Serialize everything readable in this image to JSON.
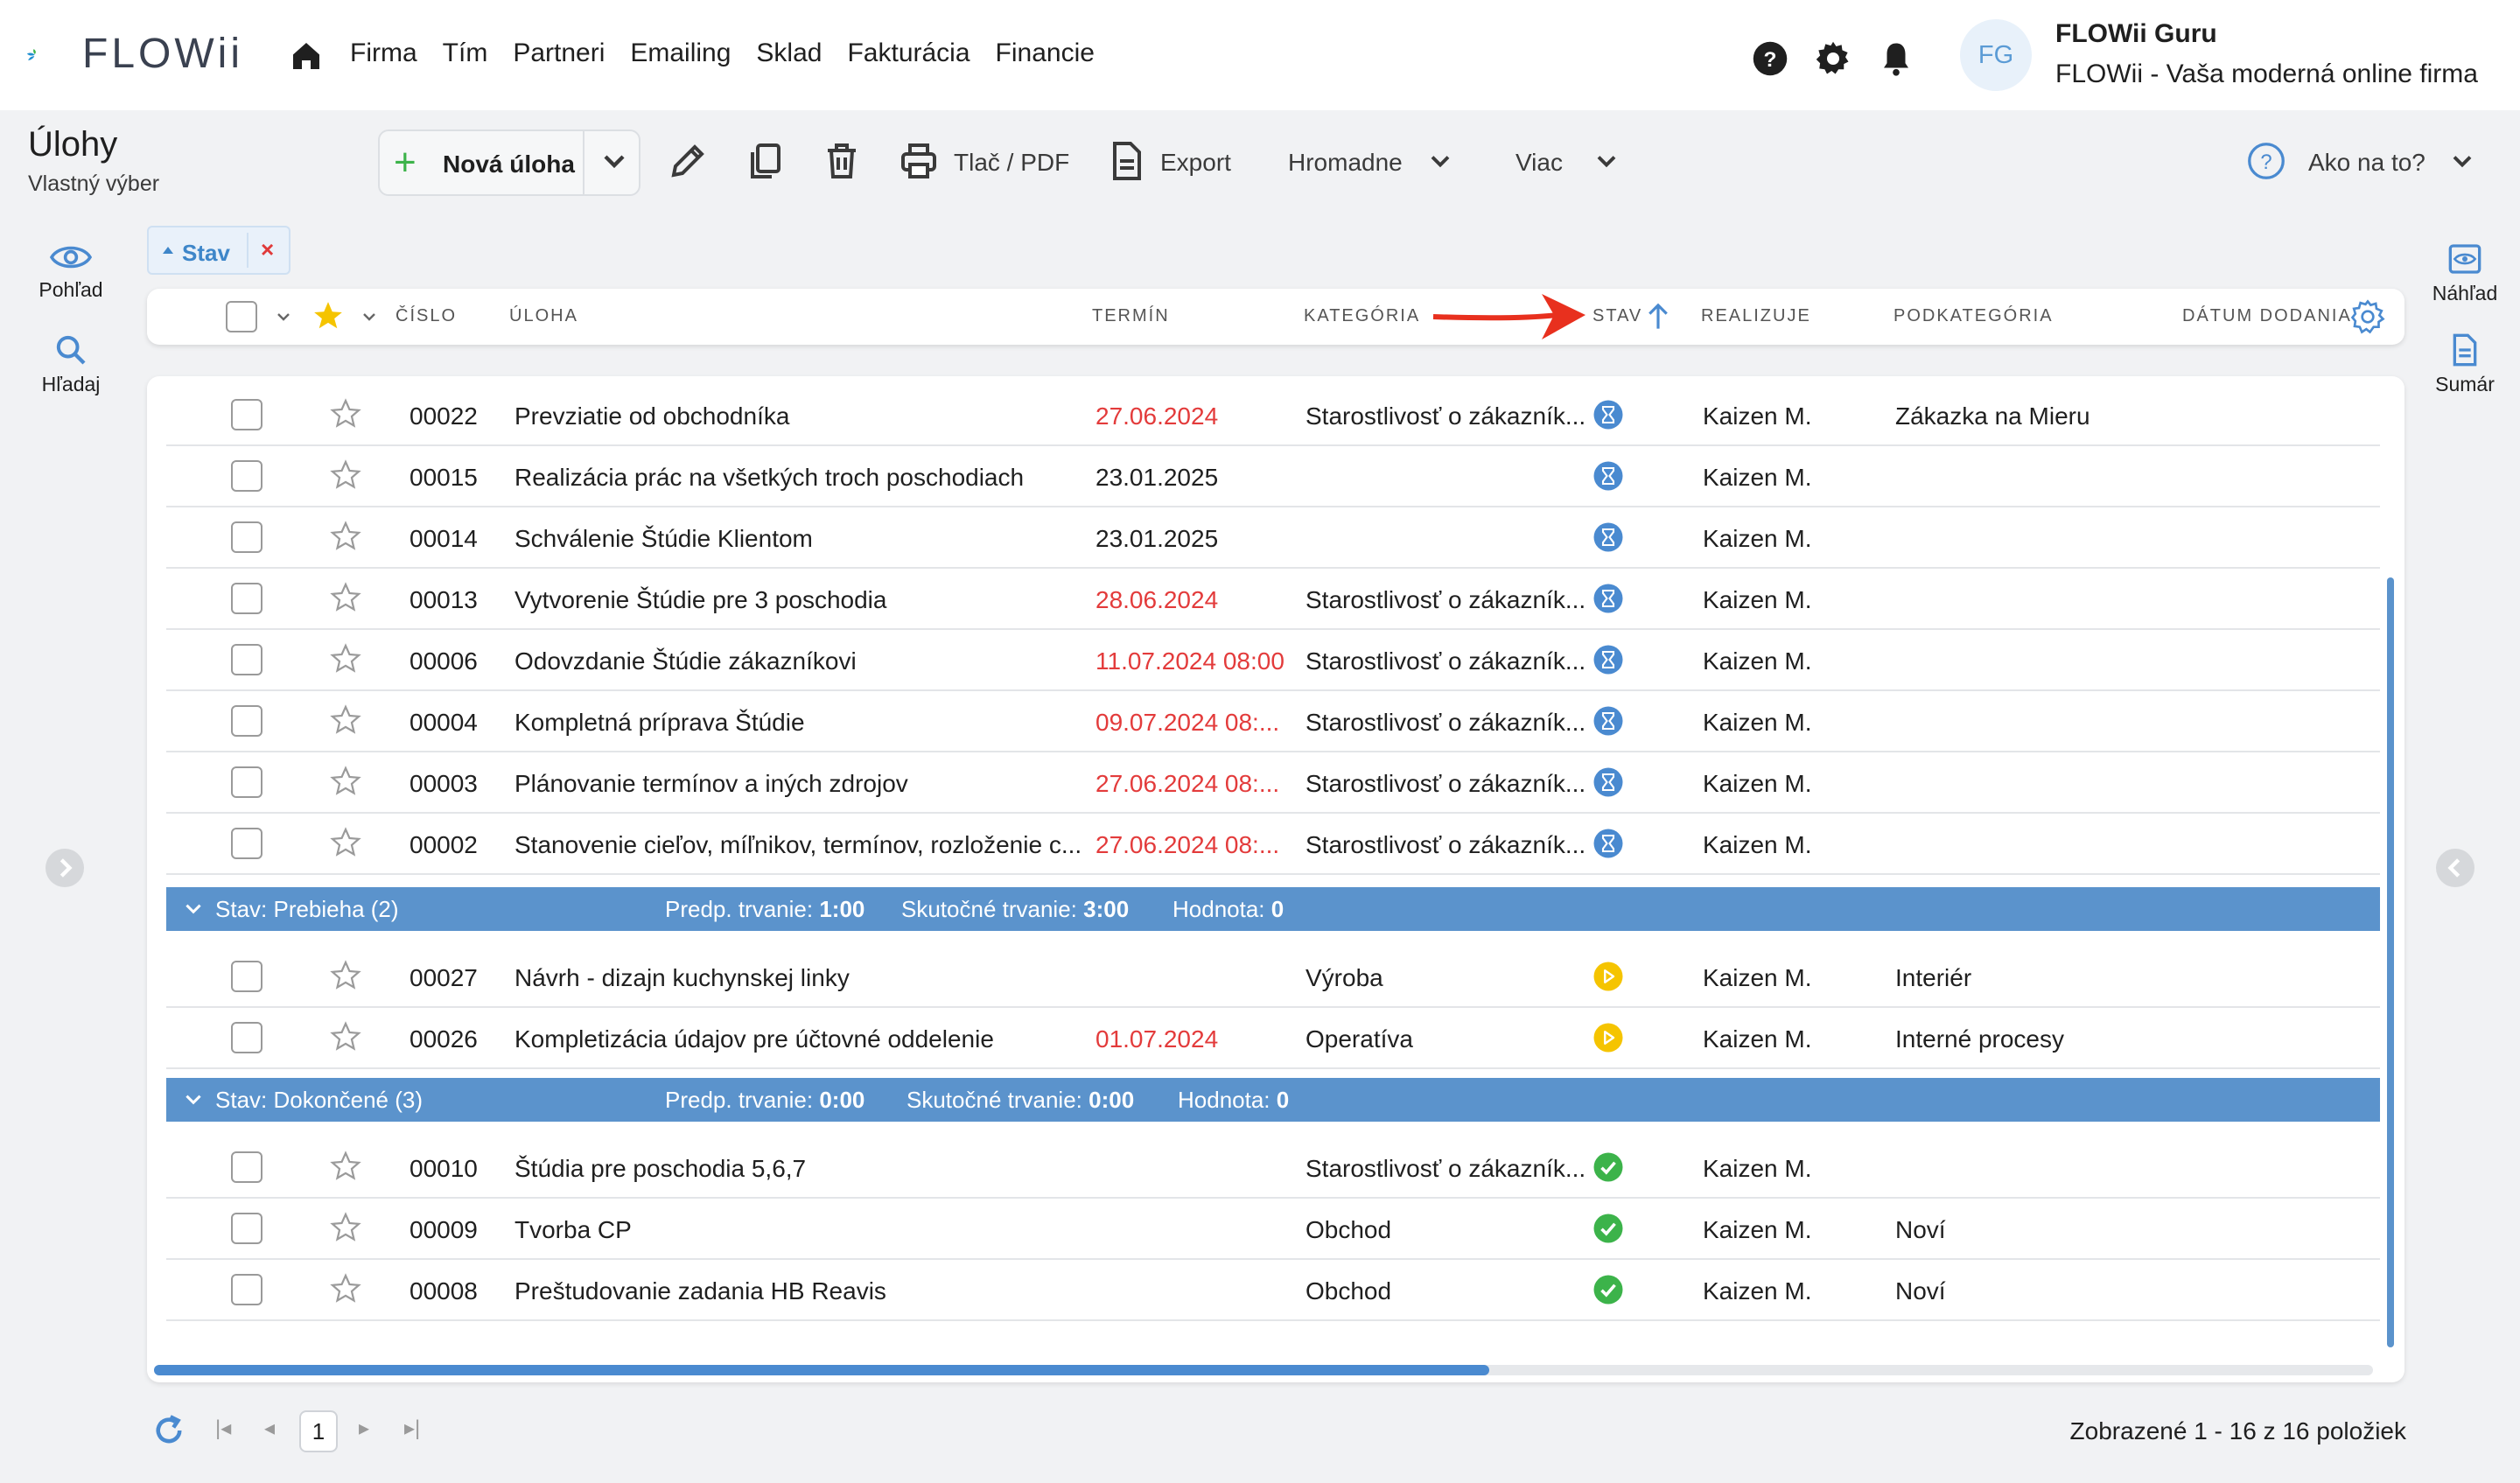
{
  "brand": {
    "name": "FLOWii"
  },
  "nav": [
    "Firma",
    "Tím",
    "Partneri",
    "Emailing",
    "Sklad",
    "Fakturácia",
    "Financie"
  ],
  "user": {
    "initials": "FG",
    "name": "FLOWii Guru",
    "company": "FLOWii - Vaša moderná online firma"
  },
  "page": {
    "title": "Úlohy",
    "subtitle": "Vlastný výber"
  },
  "toolbar": {
    "new_task": "Nová úloha",
    "print": "Tlač / PDF",
    "export": "Export",
    "bulk": "Hromadne",
    "more": "Viac",
    "help": "Ako na to?"
  },
  "side_left": {
    "view": "Pohľad",
    "search": "Hľadaj"
  },
  "side_right": {
    "preview": "Náhľad",
    "summary": "Sumár"
  },
  "filter_chip": {
    "label": "Stav"
  },
  "columns": {
    "number": "ČÍSLO",
    "task": "ÚLOHA",
    "deadline": "TERMÍN",
    "category": "KATEGÓRIA",
    "status": "STAV",
    "assignee": "REALIZUJE",
    "subcategory": "PODKATEGÓRIA",
    "delivery": "DÁTUM DODANIA"
  },
  "colors": {
    "accent": "#5b93cc",
    "overdue": "#e33b3b",
    "in_progress": "#f5c400",
    "done": "#3cb34a",
    "waiting": "#4a8ad0",
    "arrow": "#e8301e"
  },
  "rows_a": [
    {
      "num": "00022",
      "task": "Prevziatie od obchodníka",
      "date": "27.06.2024",
      "overdue": true,
      "cat": "Starostlivosť o zákazník...",
      "status": "hourglass-icon",
      "who": "Kaizen M.",
      "sub": "Zákazka na Mieru"
    },
    {
      "num": "00015",
      "task": "Realizácia prác na všetkých troch poschodiach",
      "date": "23.01.2025",
      "overdue": false,
      "cat": "",
      "status": "hourglass-icon",
      "who": "Kaizen M.",
      "sub": ""
    },
    {
      "num": "00014",
      "task": "Schválenie Štúdie Klientom",
      "date": "23.01.2025",
      "overdue": false,
      "cat": "",
      "status": "hourglass-icon",
      "who": "Kaizen M.",
      "sub": ""
    },
    {
      "num": "00013",
      "task": "Vytvorenie Štúdie pre 3 poschodia",
      "date": "28.06.2024",
      "overdue": true,
      "cat": "Starostlivosť o zákazník...",
      "status": "hourglass-icon",
      "who": "Kaizen M.",
      "sub": ""
    },
    {
      "num": "00006",
      "task": "Odovzdanie Štúdie zákazníkovi",
      "date": "11.07.2024 08:00",
      "overdue": true,
      "cat": "Starostlivosť o zákazník...",
      "status": "hourglass-icon",
      "who": "Kaizen M.",
      "sub": ""
    },
    {
      "num": "00004",
      "task": "Kompletná príprava Štúdie",
      "date": "09.07.2024 08:...",
      "overdue": true,
      "cat": "Starostlivosť o zákazník...",
      "status": "hourglass-icon",
      "who": "Kaizen M.",
      "sub": ""
    },
    {
      "num": "00003",
      "task": "Plánovanie termínov a iných zdrojov",
      "date": "27.06.2024 08:...",
      "overdue": true,
      "cat": "Starostlivosť o zákazník...",
      "status": "hourglass-icon",
      "who": "Kaizen M.",
      "sub": ""
    },
    {
      "num": "00002",
      "task": "Stanovenie cieľov, míľnikov, termínov, rozloženie c...",
      "date": "27.06.2024 08:...",
      "overdue": true,
      "cat": "Starostlivosť o zákazník...",
      "status": "hourglass-icon",
      "who": "Kaizen M.",
      "sub": ""
    }
  ],
  "group_b": {
    "title": "Stav: Prebieha (2)",
    "planned_label": "Predp. trvanie:",
    "planned": "1:00",
    "actual_label": "Skutočné trvanie:",
    "actual": "3:00",
    "value_label": "Hodnota:",
    "value": "0"
  },
  "rows_b": [
    {
      "num": "00027",
      "task": "Návrh - dizajn kuchynskej linky",
      "date": "",
      "overdue": false,
      "cat": "Výroba",
      "status": "play-icon",
      "who": "Kaizen M.",
      "sub": "Interiér"
    },
    {
      "num": "00026",
      "task": "Kompletizácia údajov pre účtovné oddelenie",
      "date": "01.07.2024",
      "overdue": true,
      "cat": "Operatíva",
      "status": "play-icon",
      "who": "Kaizen M.",
      "sub": "Interné procesy"
    }
  ],
  "group_c": {
    "title": "Stav: Dokončené (3)",
    "planned_label": "Predp. trvanie:",
    "planned": "0:00",
    "actual_label": "Skutočné trvanie:",
    "actual": "0:00",
    "value_label": "Hodnota:",
    "value": "0"
  },
  "rows_c": [
    {
      "num": "00010",
      "task": "Štúdia pre poschodia 5,6,7",
      "date": "",
      "overdue": false,
      "cat": "Starostlivosť o zákazník...",
      "status": "check-icon",
      "who": "Kaizen M.",
      "sub": ""
    },
    {
      "num": "00009",
      "task": "Tvorba CP",
      "date": "",
      "overdue": false,
      "cat": "Obchod",
      "status": "check-icon",
      "who": "Kaizen M.",
      "sub": "Noví"
    },
    {
      "num": "00008",
      "task": "Preštudovanie zadania HB Reavis",
      "date": "",
      "overdue": false,
      "cat": "Obchod",
      "status": "check-icon",
      "who": "Kaizen M.",
      "sub": "Noví"
    }
  ],
  "pager": {
    "current_page": "1",
    "info": "Zobrazené 1 - 16 z 16 položiek"
  }
}
